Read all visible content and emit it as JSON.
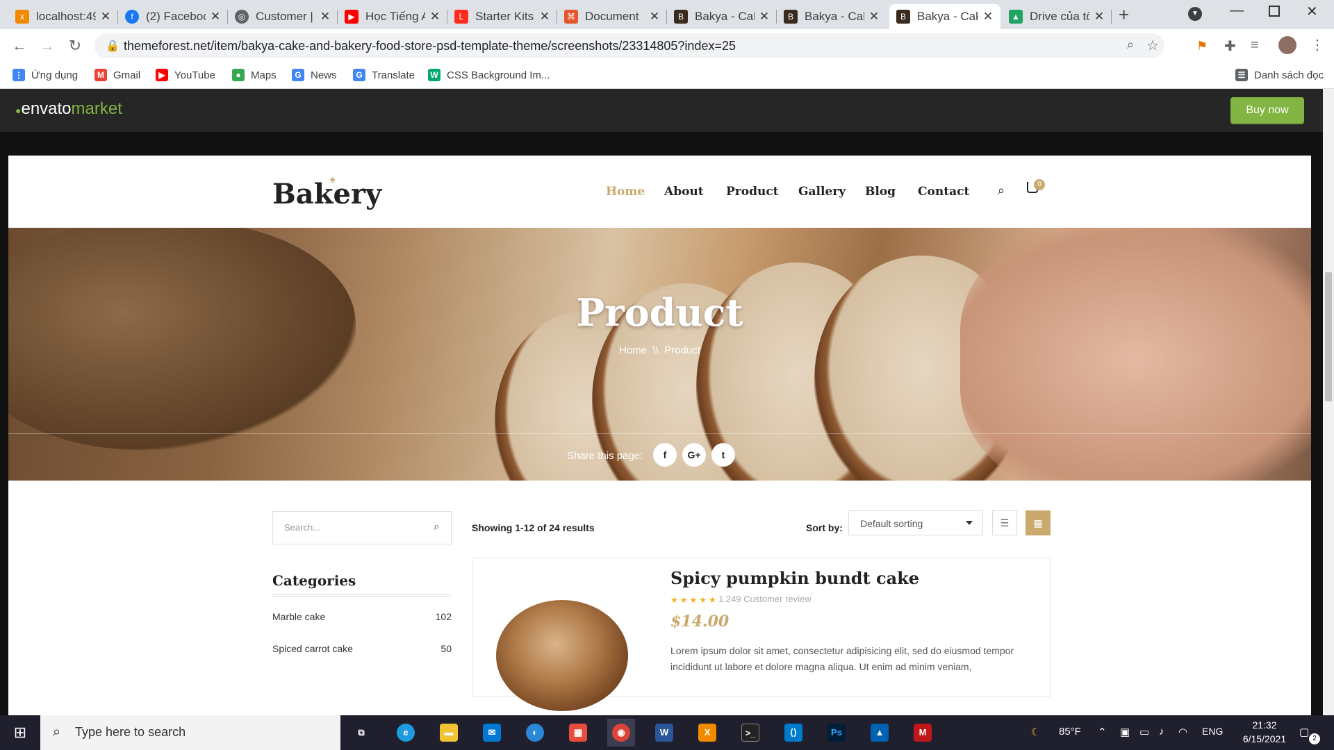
{
  "browser": {
    "tabs": [
      {
        "title": "localhost:49",
        "icon": "xampp-icon",
        "color": "#f28a00"
      },
      {
        "title": "(2) Faceboo",
        "icon": "facebook-icon",
        "color": "#1877f2"
      },
      {
        "title": "Customer | ",
        "icon": "globe-icon",
        "color": "#5f6368"
      },
      {
        "title": "Học Tiếng A",
        "icon": "youtube-icon",
        "color": "#ff0000"
      },
      {
        "title": "Starter Kits",
        "icon": "laravel-icon",
        "color": "#ff2d20"
      },
      {
        "title": "Document",
        "icon": "code-icon",
        "color": "#e4572e"
      },
      {
        "title": "Bakya - Cak",
        "icon": "bakery-icon",
        "color": "#3b2a1e"
      },
      {
        "title": "Bakya - Cak",
        "icon": "bakery-icon",
        "color": "#3b2a1e"
      },
      {
        "title": "Bakya - Cak",
        "icon": "bakery-icon",
        "color": "#3b2a1e",
        "active": true
      },
      {
        "title": "Drive của tô",
        "icon": "drive-icon",
        "color": "#1fa463"
      }
    ],
    "url": "themeforest.net/item/bakya-cake-and-bakery-food-store-psd-template-theme/screenshots/23314805?index=25",
    "bookmarks": [
      {
        "label": "Ứng dụng",
        "icon": "apps-icon",
        "color": "#4285f4"
      },
      {
        "label": "Gmail",
        "icon": "gmail-icon",
        "color": "#ea4335"
      },
      {
        "label": "YouTube",
        "icon": "youtube-icon",
        "color": "#ff0000"
      },
      {
        "label": "Maps",
        "icon": "maps-icon",
        "color": "#34a853"
      },
      {
        "label": "News",
        "icon": "news-icon",
        "color": "#4285f4"
      },
      {
        "label": "Translate",
        "icon": "translate-icon",
        "color": "#4285f4"
      },
      {
        "label": "CSS Background Im...",
        "icon": "w3-icon",
        "color": "#04aa6d"
      }
    ],
    "reading_list": "Danh sách đọc"
  },
  "envato": {
    "logo_a": "envato",
    "logo_b": "market",
    "buy_label": "Buy now"
  },
  "site": {
    "logo": "Bakery",
    "nav": [
      "Home",
      "About",
      "Product",
      "Gallery",
      "Blog",
      "Contact"
    ],
    "cart_count": "0",
    "hero": {
      "title": "Product",
      "crumb_home": "Home",
      "crumb_sep": "\\\\",
      "crumb_current": "Product",
      "share_label": "Share this page:",
      "social": [
        "f",
        "G+",
        "t"
      ]
    },
    "sidebar": {
      "search_placeholder": "Search...",
      "categories_title": "Categories",
      "categories": [
        {
          "name": "Marble cake",
          "count": "102"
        },
        {
          "name": "Spiced carrot cake",
          "count": "50"
        }
      ]
    },
    "toolbar": {
      "showing": "Showing 1-12 of 24 results",
      "sort_label": "Sort by:",
      "sort_value": "Default sorting"
    },
    "product": {
      "title": "Spicy pumpkin bundt cake",
      "rating": 5,
      "stars": "★★★★★",
      "review": "1.249 Customer review",
      "price": "$14.00",
      "description": "Lorem ipsum dolor sit amet, consectetur adipisicing elit, sed do eiusmod tempor incididunt ut labore et dolore magna aliqua. Ut enim ad minim veniam,"
    }
  },
  "taskbar": {
    "search_placeholder": "Type here to search",
    "weather": "85°F",
    "lang": "ENG",
    "time": "21:32",
    "date": "6/15/2021",
    "notif": "2"
  }
}
